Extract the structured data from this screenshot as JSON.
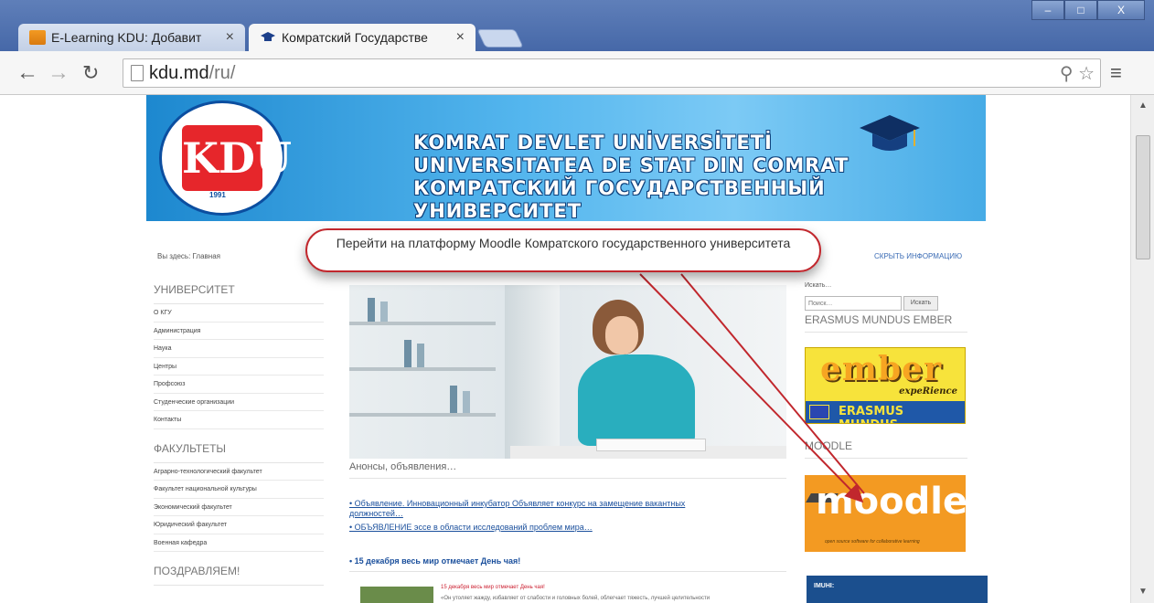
{
  "browser": {
    "tabs": [
      {
        "title": "E-Learning KDU: Добавит",
        "active": false
      },
      {
        "title": "Комратский Государстве",
        "active": true
      }
    ],
    "url_host": "kdu.md",
    "url_path": "/ru/",
    "window_controls": [
      "–",
      "□",
      "X"
    ]
  },
  "banner": {
    "lines": [
      "KOMRAT DEVLET UNİVERSİTETİ",
      "UNIVERSITATEA DE STAT DIN COMRAT",
      "КОМРАТСКИЙ ГОСУДАРСТВЕННЫЙ УНИВЕРСИТЕТ"
    ],
    "logo_text": "KDU",
    "logo_year": "1991"
  },
  "breadcrumb": "Вы здесь: Главная",
  "hide_info": "СКРЫТЬ ИНФОРМАЦИЮ",
  "callout": "Перейти на платформу Moodle Комратского государственного университета",
  "left": {
    "university_heading": "УНИВЕРСИТЕТ",
    "university_items": [
      "О КГУ",
      "Администрация",
      "Наука",
      "Центры",
      "Профсоюз",
      "Студенческие организации",
      "Контакты"
    ],
    "faculties_heading": "ФАКУЛЬТЕТЫ",
    "faculties_items": [
      "Аграрно-технологический факультет",
      "Факультет национальной культуры",
      "Экономический факультет",
      "Юридический факультет",
      "Военная кафедра"
    ],
    "congrats_heading": "ПОЗДРАВЛЯЕМ!"
  },
  "main": {
    "announcements_heading": "Анонсы, объявления…",
    "links": [
      "• Объявление. Инновационный инкубатор Объявляет конкурс на замещение вакантных должностей…",
      "• ОБЪЯВЛЕНИЕ эссе в области исследований проблем мира…"
    ],
    "featured_title": "• 15 декабря весь мир отмечает День чая!",
    "excerpt_red": "15 декабря весь мир отмечает День чая!",
    "excerpt_gray": "«Он утоляет жажду, избавляет от слабости и головных болей, облегчает тяжесть, лучшей целительности"
  },
  "right": {
    "search_label": "Искать…",
    "search_placeholder": "Поиск…",
    "search_button": "Искать",
    "erasmus_heading": "ERASMUS MUNDUS EMBER",
    "ember_word": "ember",
    "ember_experience": "expeRience",
    "ember_erasmus": "ERASMUS MUNDUS",
    "moodle_heading": "MOODLE",
    "moodle_word": "moodle",
    "moodle_tagline": "open source software for collaborative learning",
    "bottom_box_label": "IMUHI:"
  },
  "colors": {
    "accent_red": "#c1272d",
    "link_blue": "#1a4f9c",
    "moodle_orange": "#f39a22",
    "ember_yellow": "#f7e33b"
  }
}
